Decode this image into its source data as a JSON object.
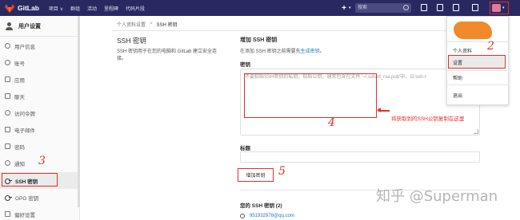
{
  "topbar": {
    "brand": "GitLab",
    "nav": [
      "项目 ∨",
      "群组",
      "活动",
      "里程碑",
      "代码片段"
    ],
    "plus": "+",
    "search_placeholder": "搜索"
  },
  "sidebar": {
    "title": "用户设置",
    "items": [
      {
        "label": "用户信息",
        "icon": "user-icon"
      },
      {
        "label": "账号",
        "icon": "gear-icon"
      },
      {
        "label": "应用",
        "icon": "cloud-icon"
      },
      {
        "label": "聊天",
        "icon": "chat-icon"
      },
      {
        "label": "访问令牌",
        "icon": "link-icon"
      },
      {
        "label": "电子邮件",
        "icon": "envelope-icon"
      },
      {
        "label": "密码",
        "icon": "lock-icon"
      },
      {
        "label": "通知",
        "icon": "bell-icon"
      },
      {
        "label": "SSH 密钥",
        "icon": "key-icon",
        "active": true
      },
      {
        "label": "GPG 密钥",
        "icon": "key-icon"
      },
      {
        "label": "偏好设置",
        "icon": "sliders-icon"
      }
    ]
  },
  "breadcrumb": {
    "parent": "个人资料设置",
    "separator": ">",
    "current": "SSH 密钥"
  },
  "section": {
    "title": "SSH 密钥",
    "description": "SSH 密钥用于在您的电脑和 GitLab 建立安全连接。"
  },
  "form": {
    "heading": "增加 SSH 密钥",
    "hint_prefix": "在添加 SSH 密钥之前需要先",
    "hint_link": "生成密钥",
    "hint_suffix": "。",
    "key_label": "密钥",
    "key_placeholder": "不要粘贴SSH密钥的私钥。粘贴公钥，通常包含在文件 '~/.ssh/id_rsa.pub'中，以'ssh-r",
    "title_label": "标题",
    "add_button": "增加密钥",
    "keys_heading": "您的 SSH 密钥 (2)",
    "key_entry": "951932978@qq.com"
  },
  "annotations": {
    "textarea_note": "将获取到的SSH公钥复制在这里",
    "step2": "2",
    "step3": "3",
    "step4": "4",
    "step5": "5",
    "color": "#e0302a"
  },
  "dropdown": {
    "items": [
      "个人资料",
      "设置",
      "帮助",
      "退出"
    ],
    "highlighted": "设置"
  },
  "watermark": "知乎 @Superman",
  "colors": {
    "nav": "#292961",
    "accent": "#e0302a",
    "link": "#1f78d1"
  }
}
